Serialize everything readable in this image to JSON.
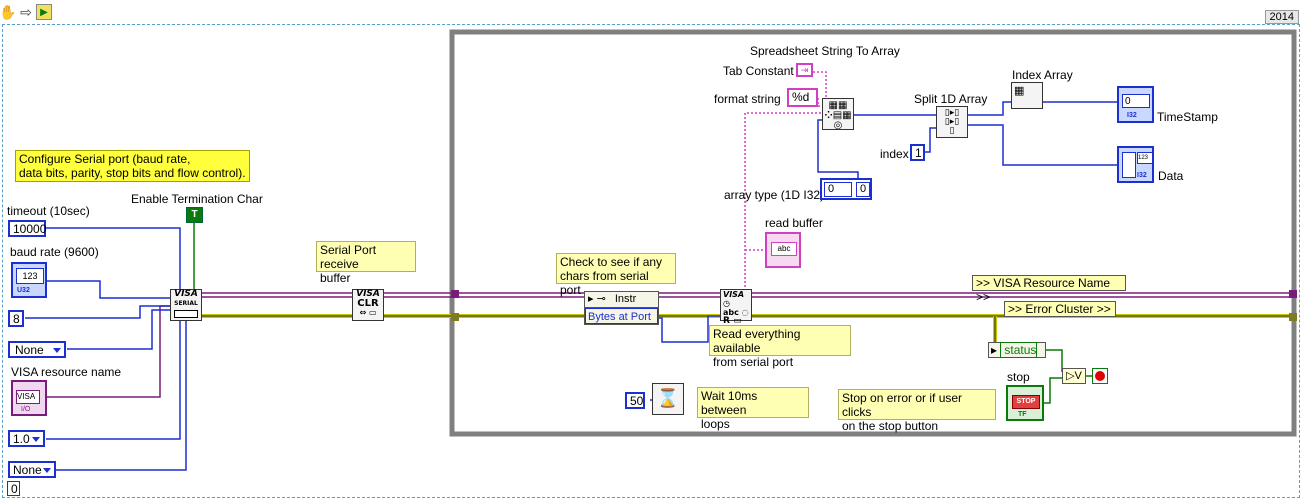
{
  "toolbar": {
    "version": "2014"
  },
  "comments": {
    "configure": "Configure Serial port (baud rate,\ndata bits, parity, stop bits and flow control).",
    "receive_buffer": "Serial Port receive\nbuffer",
    "check_chars": "Check to see if any\nchars from serial port",
    "read_everything": "Read everything available\nfrom serial port",
    "wait": "Wait 10ms between\nloops",
    "stop_on_error": "Stop on error or if user clicks\non the stop button"
  },
  "labels": {
    "timeout": "timeout (10sec)",
    "baud_rate": "baud rate (9600)",
    "visa_resource_name": "VISA resource name",
    "enable_termination": "Enable Termination Char",
    "spreadsheet": "Spreadsheet String To Array",
    "tab_constant": "Tab Constant",
    "format_string": "format string",
    "split": "Split 1D Array",
    "index_array": "Index Array",
    "index": "index",
    "array_type": "array type (1D I32)",
    "read_buffer": "read buffer",
    "timestamp": "TimeStamp",
    "data": "Data",
    "stop": "stop",
    "status": "status",
    "visa_resource_tag": ">> VISA Resource Name >>",
    "error_cluster_tag": ">> Error Cluster >>"
  },
  "constants": {
    "timeout": "10000",
    "data_bits": "8",
    "parity": "None",
    "stop_bits": "1.0",
    "flow": "None",
    "bottom_zero": "0",
    "format": "%d",
    "index": "1",
    "array_zero": "0",
    "array_elem": "0",
    "wait_ms": "50",
    "instr": "Instr",
    "bytes_at_port": "Bytes at Port",
    "true_const": "T",
    "numeric_display": "123",
    "timestamp_zero": "0",
    "visa_text": "VISA"
  },
  "colors": {
    "wire_blue": "#1c2fd0",
    "wire_string": "#d040c0",
    "wire_error": "#c8c800",
    "wire_visa": "#7a1c7a",
    "loop_border": "#808080",
    "bool_green": "#0a7a0a"
  }
}
